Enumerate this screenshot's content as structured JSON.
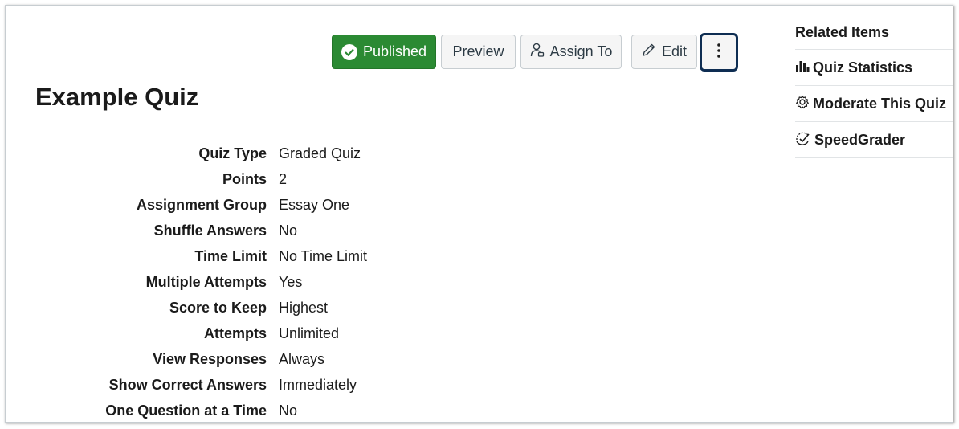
{
  "toolbar": {
    "published_label": "Published",
    "preview_label": "Preview",
    "assign_label": "Assign To",
    "edit_label": "Edit",
    "more_icon": "kebab-vertical-icon"
  },
  "page": {
    "title": "Example Quiz"
  },
  "details": [
    {
      "label": "Quiz Type",
      "value": "Graded Quiz"
    },
    {
      "label": "Points",
      "value": "2"
    },
    {
      "label": "Assignment Group",
      "value": "Essay One"
    },
    {
      "label": "Shuffle Answers",
      "value": "No"
    },
    {
      "label": "Time Limit",
      "value": "No Time Limit"
    },
    {
      "label": "Multiple Attempts",
      "value": "Yes"
    },
    {
      "label": "Score to Keep",
      "value": "Highest"
    },
    {
      "label": "Attempts",
      "value": "Unlimited"
    },
    {
      "label": "View Responses",
      "value": "Always"
    },
    {
      "label": "Show Correct Answers",
      "value": "Immediately"
    },
    {
      "label": "One Question at a Time",
      "value": "No"
    }
  ],
  "sidebar": {
    "heading": "Related Items",
    "items": [
      {
        "label": "Quiz Statistics",
        "icon": "bar-chart-icon"
      },
      {
        "label": "Moderate This Quiz",
        "icon": "gear-icon"
      },
      {
        "label": "SpeedGrader",
        "icon": "speedgrader-icon"
      }
    ]
  },
  "colors": {
    "published_bg": "#2b8a33",
    "focus_ring": "#0e2d52",
    "button_bg": "#f5f5f5"
  }
}
